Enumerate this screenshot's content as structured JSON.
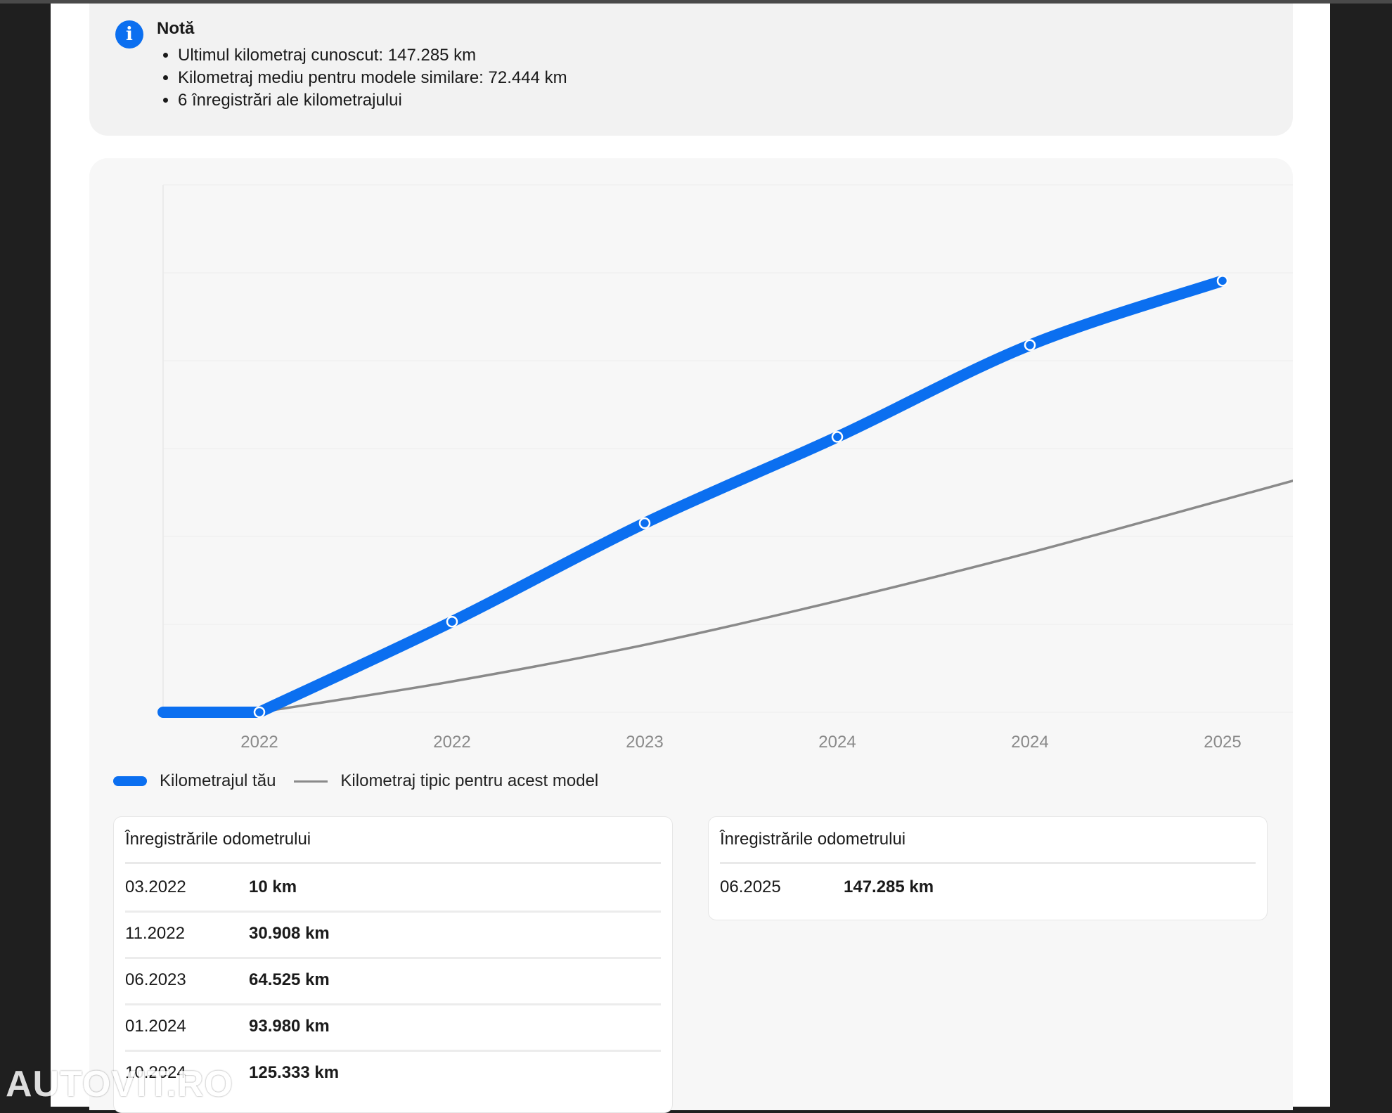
{
  "note": {
    "title": "Notă",
    "items": [
      "Ultimul kilometraj cunoscut: 147.285 km",
      "Kilometraj mediu pentru modele similare: 72.444 km",
      "6 înregistrări ale kilometrajului"
    ],
    "icon": "info-icon"
  },
  "chart_data": {
    "type": "line",
    "x_tick_labels": [
      "2022",
      "2022",
      "2023",
      "2024",
      "2024",
      "2025"
    ],
    "x": [
      "03.2022",
      "11.2022",
      "06.2023",
      "01.2024",
      "10.2024",
      "06.2025"
    ],
    "series": [
      {
        "name": "Kilometrajul tău",
        "values": [
          10,
          30908,
          64525,
          93980,
          125333,
          147285
        ],
        "color": "#0b6ff0"
      },
      {
        "name": "Kilometraj tipic pentru acest model",
        "values": [
          0,
          10500,
          23000,
          38000,
          54500,
          72444
        ],
        "color": "#8a8a8a"
      }
    ],
    "ylim": [
      0,
      180000
    ],
    "grid": true,
    "legend_position": "bottom-left"
  },
  "legend": {
    "series_1": "Kilometrajul tău",
    "series_2": "Kilometraj tipic pentru acest model"
  },
  "tables": [
    {
      "header": "Înregistrările odometrului",
      "rows": [
        {
          "date": "03.2022",
          "value": "10 km"
        },
        {
          "date": "11.2022",
          "value": "30.908 km"
        },
        {
          "date": "06.2023",
          "value": "64.525 km"
        },
        {
          "date": "01.2024",
          "value": "93.980 km"
        },
        {
          "date": "10.2024",
          "value": "125.333 km"
        }
      ]
    },
    {
      "header": "Înregistrările odometrului",
      "rows": [
        {
          "date": "06.2025",
          "value": "147.285 km"
        }
      ]
    }
  ],
  "watermark": "AUTOVIT.RO"
}
